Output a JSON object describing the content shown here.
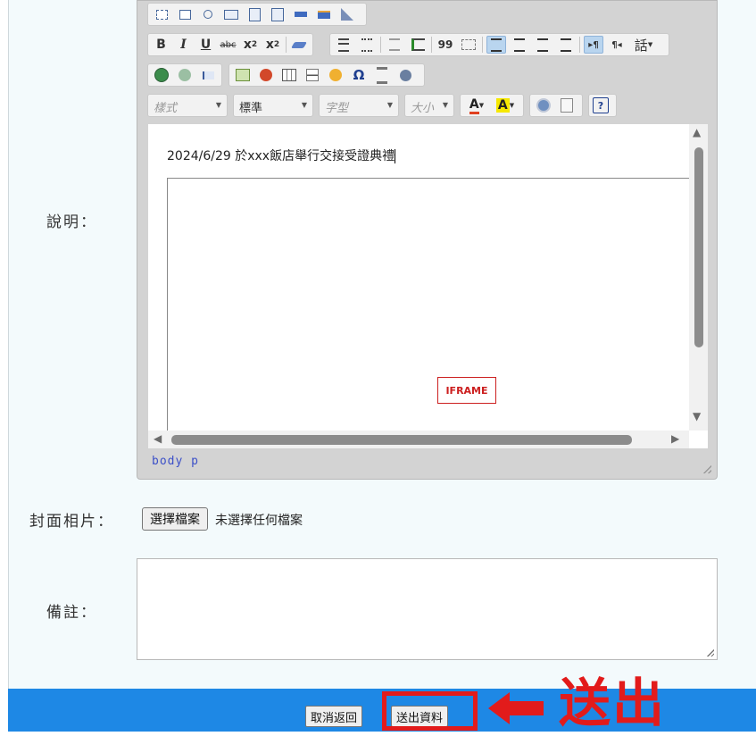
{
  "labels": {
    "description": "說明：",
    "cover_photo": "封面相片：",
    "remarks": "備註："
  },
  "toolbar": {
    "row1": [
      "select-field-icon",
      "checkbox-icon",
      "radio-icon",
      "textfield-icon",
      "textarea-icon",
      "selectlist-icon",
      "button-icon",
      "image-button-icon",
      "hidden-field-icon"
    ],
    "row2": {
      "bold": "B",
      "italic": "I",
      "underline": "U",
      "strike": "abc",
      "subscript": "x",
      "superscript": "x",
      "blockquote": "99",
      "bidi_ltr": "▸¶",
      "bidi_rtl": "¶◂",
      "language": "話"
    },
    "combos": {
      "styles": "樣式",
      "format": "標準",
      "font": "字型",
      "size": "大小"
    },
    "special_char": "Ω",
    "help": "?"
  },
  "editor": {
    "content_text": "2024/6/29 於xxx飯店舉行交接受證典禮",
    "iframe_placeholder": "IFRAME",
    "element_path": "body  p"
  },
  "cover": {
    "file_button": "選擇檔案",
    "no_file": "未選擇任何檔案"
  },
  "footer": {
    "cancel_label": "取消返回",
    "submit_label": "送出資料"
  },
  "annotation": {
    "text": "送出",
    "color": "#e21b1b"
  },
  "colors": {
    "footer_bg": "#1e88e5",
    "page_bg": "#f3fafc"
  }
}
